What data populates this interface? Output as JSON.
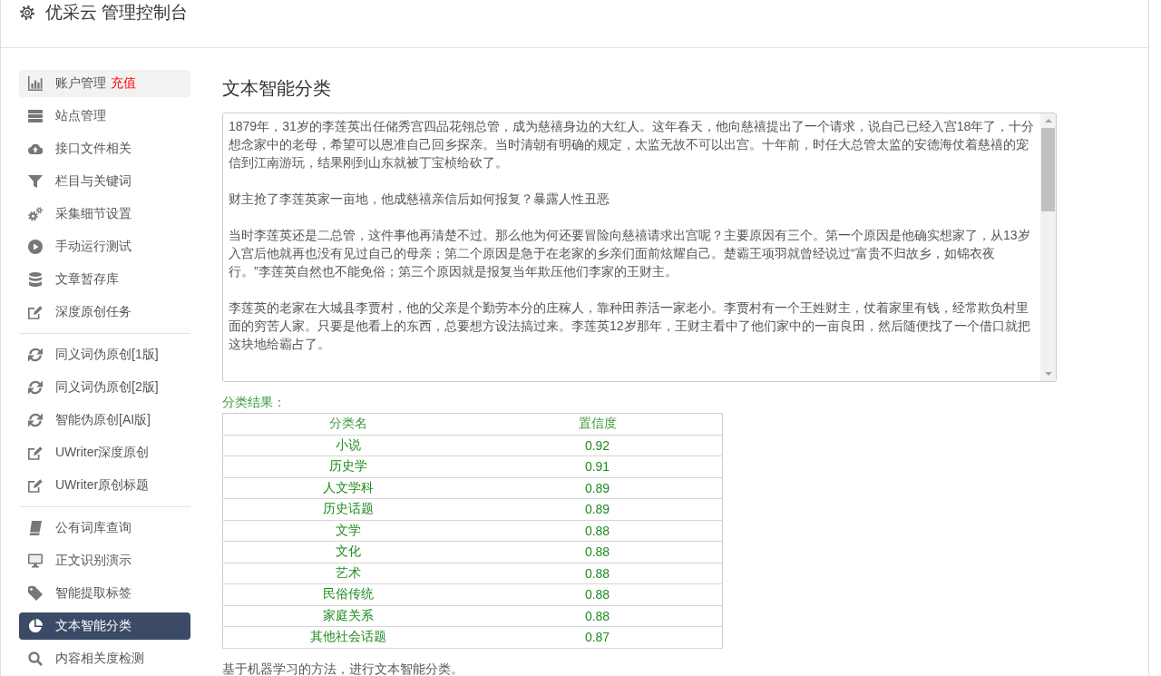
{
  "header": {
    "title": "优采云 管理控制台"
  },
  "sidebar": {
    "groups": [
      {
        "items": [
          {
            "label": "账户管理",
            "badge": "充值",
            "highlighted": true,
            "selected": false
          },
          {
            "label": "站点管理",
            "highlighted": false,
            "selected": false
          },
          {
            "label": "接口文件相关",
            "highlighted": false,
            "selected": false
          },
          {
            "label": "栏目与关键词",
            "highlighted": false,
            "selected": false
          },
          {
            "label": "采集细节设置",
            "highlighted": false,
            "selected": false
          },
          {
            "label": "手动运行测试",
            "highlighted": false,
            "selected": false
          },
          {
            "label": "文章暂存库",
            "highlighted": false,
            "selected": false
          },
          {
            "label": "深度原创任务",
            "highlighted": false,
            "selected": false
          }
        ]
      },
      {
        "items": [
          {
            "label": "同义词伪原创[1版]",
            "highlighted": false,
            "selected": false
          },
          {
            "label": "同义词伪原创[2版]",
            "highlighted": false,
            "selected": false
          },
          {
            "label": "智能伪原创[AI版]",
            "highlighted": false,
            "selected": false
          },
          {
            "label": "UWriter深度原创",
            "highlighted": false,
            "selected": false
          },
          {
            "label": "UWriter原创标题",
            "highlighted": false,
            "selected": false
          }
        ]
      },
      {
        "items": [
          {
            "label": "公有词库查询",
            "highlighted": false,
            "selected": false
          },
          {
            "label": "正文识别演示",
            "highlighted": false,
            "selected": false
          },
          {
            "label": "智能提取标签",
            "highlighted": false,
            "selected": false
          },
          {
            "label": "文本智能分类",
            "highlighted": false,
            "selected": true
          },
          {
            "label": "内容相关度检测",
            "highlighted": false,
            "selected": false
          }
        ]
      }
    ]
  },
  "main": {
    "title": "文本智能分类",
    "article": {
      "paragraphs": [
        "1879年，31岁的李莲英出任储秀宫四品花翎总管，成为慈禧身边的大红人。这年春天，他向慈禧提出了一个请求，说自己已经入宫18年了，十分想念家中的老母，希望可以恩准自己回乡探亲。当时清朝有明确的规定，太监无故不可以出宫。十年前，时任大总管太监的安德海仗着慈禧的宠信到江南游玩，结果刚到山东就被丁宝桢给砍了。",
        "财主抢了李莲英家一亩地，他成慈禧亲信后如何报复？暴露人性丑恶",
        "当时李莲英还是二总管，这件事他再清楚不过。那么他为何还要冒险向慈禧请求出宫呢？主要原因有三个。第一个原因是他确实想家了，从13岁入宫后他就再也没有见过自己的母亲；第二个原因是急于在老家的乡亲们面前炫耀自己。楚霸王项羽就曾经说过“富贵不归故乡，如锦衣夜行。”李莲英自然也不能免俗；第三个原因就是报复当年欺压他们李家的王财主。",
        "李莲英的老家在大城县李贾村，他的父亲是个勤劳本分的庄稼人，靠种田养活一家老小。李贾村有一个王姓财主，仗着家里有钱，经常欺负村里面的穷苦人家。只要是他看上的东西，总要想方设法搞过来。李莲英12岁那年，王财主看中了他们家中的一亩良田，然后随便找了一个借口就把这块地给霸占了。"
      ]
    },
    "result_label": "分类结果：",
    "results_table": {
      "columns": [
        "分类名",
        "置信度"
      ],
      "rows": [
        [
          "小说",
          "0.92"
        ],
        [
          "历史学",
          "0.91"
        ],
        [
          "人文学科",
          "0.89"
        ],
        [
          "历史话题",
          "0.89"
        ],
        [
          "文学",
          "0.88"
        ],
        [
          "文化",
          "0.88"
        ],
        [
          "艺术",
          "0.88"
        ],
        [
          "民俗传统",
          "0.88"
        ],
        [
          "家庭关系",
          "0.88"
        ],
        [
          "其他社会话题",
          "0.87"
        ]
      ]
    },
    "note": "基于机器学习的方法，进行文本智能分类。"
  }
}
